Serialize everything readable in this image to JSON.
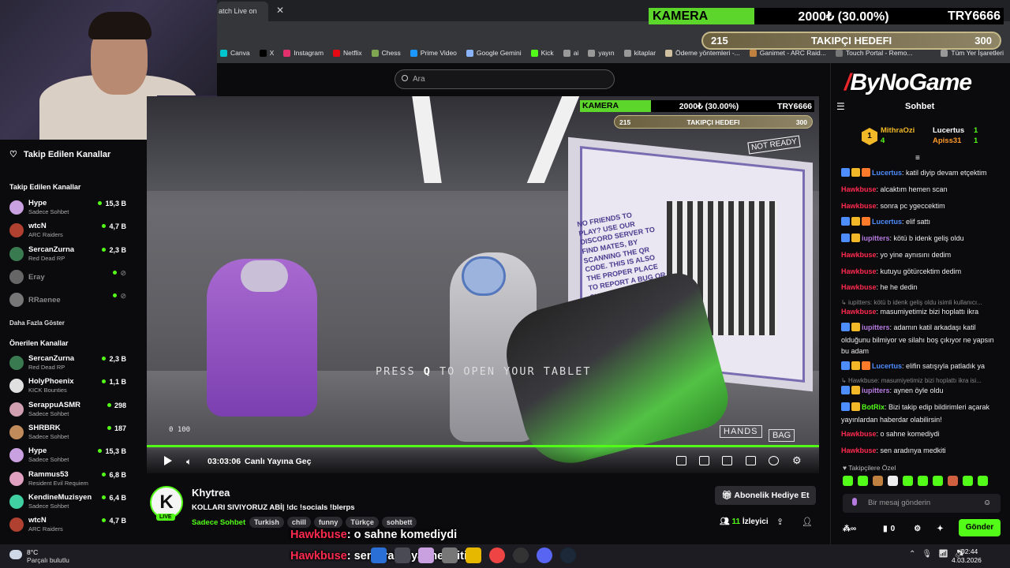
{
  "browser": {
    "tab_title": "atch Live on",
    "bookmarks": [
      "Canva",
      "X",
      "Instagram",
      "Netflix",
      "Chess",
      "Prime Video",
      "Google Gemini",
      "Kick",
      "ai",
      "yayın",
      "kitaplar",
      "Ödeme yöntemleri -...",
      "Ganimet - ARC Raid...",
      "Touch Portal - Remo...",
      "Tüm Yer İşaretleri"
    ]
  },
  "overlay": {
    "kamera_label": "KAMERA",
    "kamera_value": "2000₺ (30.00%)",
    "kamera_currency": "TRY6666",
    "kamera_progress": 0.3,
    "takipci_current": "215",
    "takipci_label": "TAKIPÇI HEDEFI",
    "takipci_goal": "300"
  },
  "search": {
    "placeholder": "Ara"
  },
  "sidebar": {
    "header": "Takip Edilen Kanallar",
    "followed_title": "Takip Edilen Kanallar",
    "followed": [
      {
        "name": "Hype",
        "sub": "Sadece Sohbet",
        "viewers": "15,3 B",
        "color": "#c9a0e0"
      },
      {
        "name": "wtcN",
        "sub": "ARC Raiders",
        "viewers": "4,7 B",
        "color": "#b04030"
      },
      {
        "name": "SercanZurna",
        "sub": "Red Dead RP",
        "viewers": "2,3 B",
        "color": "#3a7a50"
      },
      {
        "name": "Eray",
        "sub": "",
        "viewers": "",
        "color": "#666"
      },
      {
        "name": "RRaenee",
        "sub": "",
        "viewers": "",
        "color": "#777"
      }
    ],
    "show_more": "Daha Fazla Göster",
    "recommended_title": "Önerilen Kanallar",
    "recommended": [
      {
        "name": "SercanZurna",
        "sub": "Red Dead RP",
        "viewers": "2,3 B",
        "color": "#3a7a50"
      },
      {
        "name": "HolyPhoenix",
        "sub": "KICK Bounties",
        "viewers": "1,1 B",
        "color": "#e0e0e0"
      },
      {
        "name": "SerappuASMR",
        "sub": "Sadece Sohbet",
        "viewers": "298",
        "color": "#d0a0b0"
      },
      {
        "name": "SHRBRK",
        "sub": "Sadece Sohbet",
        "viewers": "187",
        "color": "#c08a5a"
      },
      {
        "name": "Hype",
        "sub": "Sadece Sohbet",
        "viewers": "15,3 B",
        "color": "#c9a0e0"
      },
      {
        "name": "Rammus53",
        "sub": "Resident Evil Requiem",
        "viewers": "6,8 B",
        "color": "#e0a0c0"
      },
      {
        "name": "KendineMuzisyen",
        "sub": "Sadece Sohbet",
        "viewers": "6,4 B",
        "color": "#3fcfa0"
      },
      {
        "name": "wtcN",
        "sub": "ARC Raiders",
        "viewers": "4,7 B",
        "color": "#b04030"
      }
    ]
  },
  "video": {
    "press_text_a": "PRESS ",
    "press_key": "Q",
    "press_text_b": " TO OPEN YOUR TABLET",
    "hud_hands": "HANDS",
    "hud_bag": "BAG",
    "hud_ammo": "100",
    "game_ready": "NOT READY",
    "poster_text": "NO FRIENDS TO PLAY? USE OUR DISCORD SERVER TO FIND MATES, BY SCANNING THE QR CODE. THIS IS ALSO THE PROPER PLACE TO REPORT A BUG OR SHARE A SUGGESTION!",
    "time": "03:03:06",
    "go_live": "Canlı Yayına Geç",
    "progress": 1.0
  },
  "stream": {
    "avatar_letter": "K",
    "live": "LIVE",
    "name": "Khytrea",
    "title": "KOLLARI SIVIYORUZ ABİ| !dc !socials !blerps",
    "category": "Sadece Sohbet",
    "tags": [
      "Turkish",
      "chill",
      "funny",
      "Türkçe",
      "sohbett"
    ],
    "gift_label": "Abonelik Hediye Et",
    "viewers": "11",
    "viewers_label": "İzleyici"
  },
  "captions": [
    {
      "user": "Hawkbuse",
      "text": ": o sahne komediydi"
    },
    {
      "user": "Hawkbuse",
      "text": ": sen aradınya medkiti"
    }
  ],
  "chat": {
    "brand_a": "By",
    "brand_b": "NoGame",
    "title": "Sohbet",
    "top_gifters": [
      {
        "name": "MithraOzi",
        "count": "4",
        "rank": "1"
      },
      {
        "name": "Lucertus",
        "count": "1"
      },
      {
        "name": "Apiss31",
        "count": "1"
      }
    ],
    "messages": [
      {
        "user": "Lucertus",
        "color": "#4e8dff",
        "text": ": katil diyip devam etçektim",
        "badges": 3
      },
      {
        "user": "Hawkbuse",
        "color": "#ff2a4f",
        "text": ": alcaktım hemen scan",
        "badges": 0
      },
      {
        "user": "Hawkbuse",
        "color": "#ff2a4f",
        "text": ": sonra pc ygeccektim",
        "badges": 0
      },
      {
        "user": "Lucertus",
        "color": "#4e8dff",
        "text": ": elif sattı",
        "badges": 3
      },
      {
        "user": "iupitters",
        "color": "#b57be0",
        "text": ": kötü b idenk geliş oldu",
        "badges": 2
      },
      {
        "user": "Hawkbuse",
        "color": "#ff2a4f",
        "text": ": yo yine aynısını dedim",
        "badges": 0
      },
      {
        "user": "Hawkbuse",
        "color": "#ff2a4f",
        "text": ": kutuyu götürcektim dedim",
        "badges": 0
      },
      {
        "user": "Hawkbuse",
        "color": "#ff2a4f",
        "text": ": he he dedin",
        "badges": 0
      },
      {
        "reply": "iupitters: kötü b idenk geliş oldu isimli kullanıcı..."
      },
      {
        "user": "Hawkbuse",
        "color": "#ff2a4f",
        "text": ": masumiyetimiz bizi hoplattı ikra",
        "badges": 0
      },
      {
        "user": "iupitters",
        "color": "#b57be0",
        "text": ": adamın katil arkadaşı katil olduğunu bilmiyor ve silahı boş çıkıyor ne yapsın bu adam",
        "badges": 2
      },
      {
        "user": "Lucertus",
        "color": "#4e8dff",
        "text": ": elifin satışıyla patladık ya",
        "badges": 3
      },
      {
        "reply": "Hawkbuse: masumiyetimiz bizi hoplattı ikra isi..."
      },
      {
        "user": "iupitters",
        "color": "#b57be0",
        "text": ": aynen öyle oldu",
        "badges": 2
      },
      {
        "user": "BotRix",
        "color": "#53fc18",
        "text": ": Bizi takip edip bildirimleri açarak yayınlardan haberdar olabilirsin!",
        "badges": 2
      },
      {
        "user": "Hawkbuse",
        "color": "#ff2a4f",
        "text": ": o sahne komediydi",
        "badges": 0
      },
      {
        "user": "Hawkbuse",
        "color": "#ff2a4f",
        "text": ": sen aradınya medkiti",
        "badges": 0
      }
    ],
    "followers_only": "Takipçilere Özel",
    "input_placeholder": "Bir mesaj gönderin",
    "points": "0",
    "send": "Gönder"
  },
  "taskbar": {
    "temp": "8°C",
    "weather": "Parçalı bulutlu",
    "time": "02:44",
    "date": "4.03.2026"
  }
}
